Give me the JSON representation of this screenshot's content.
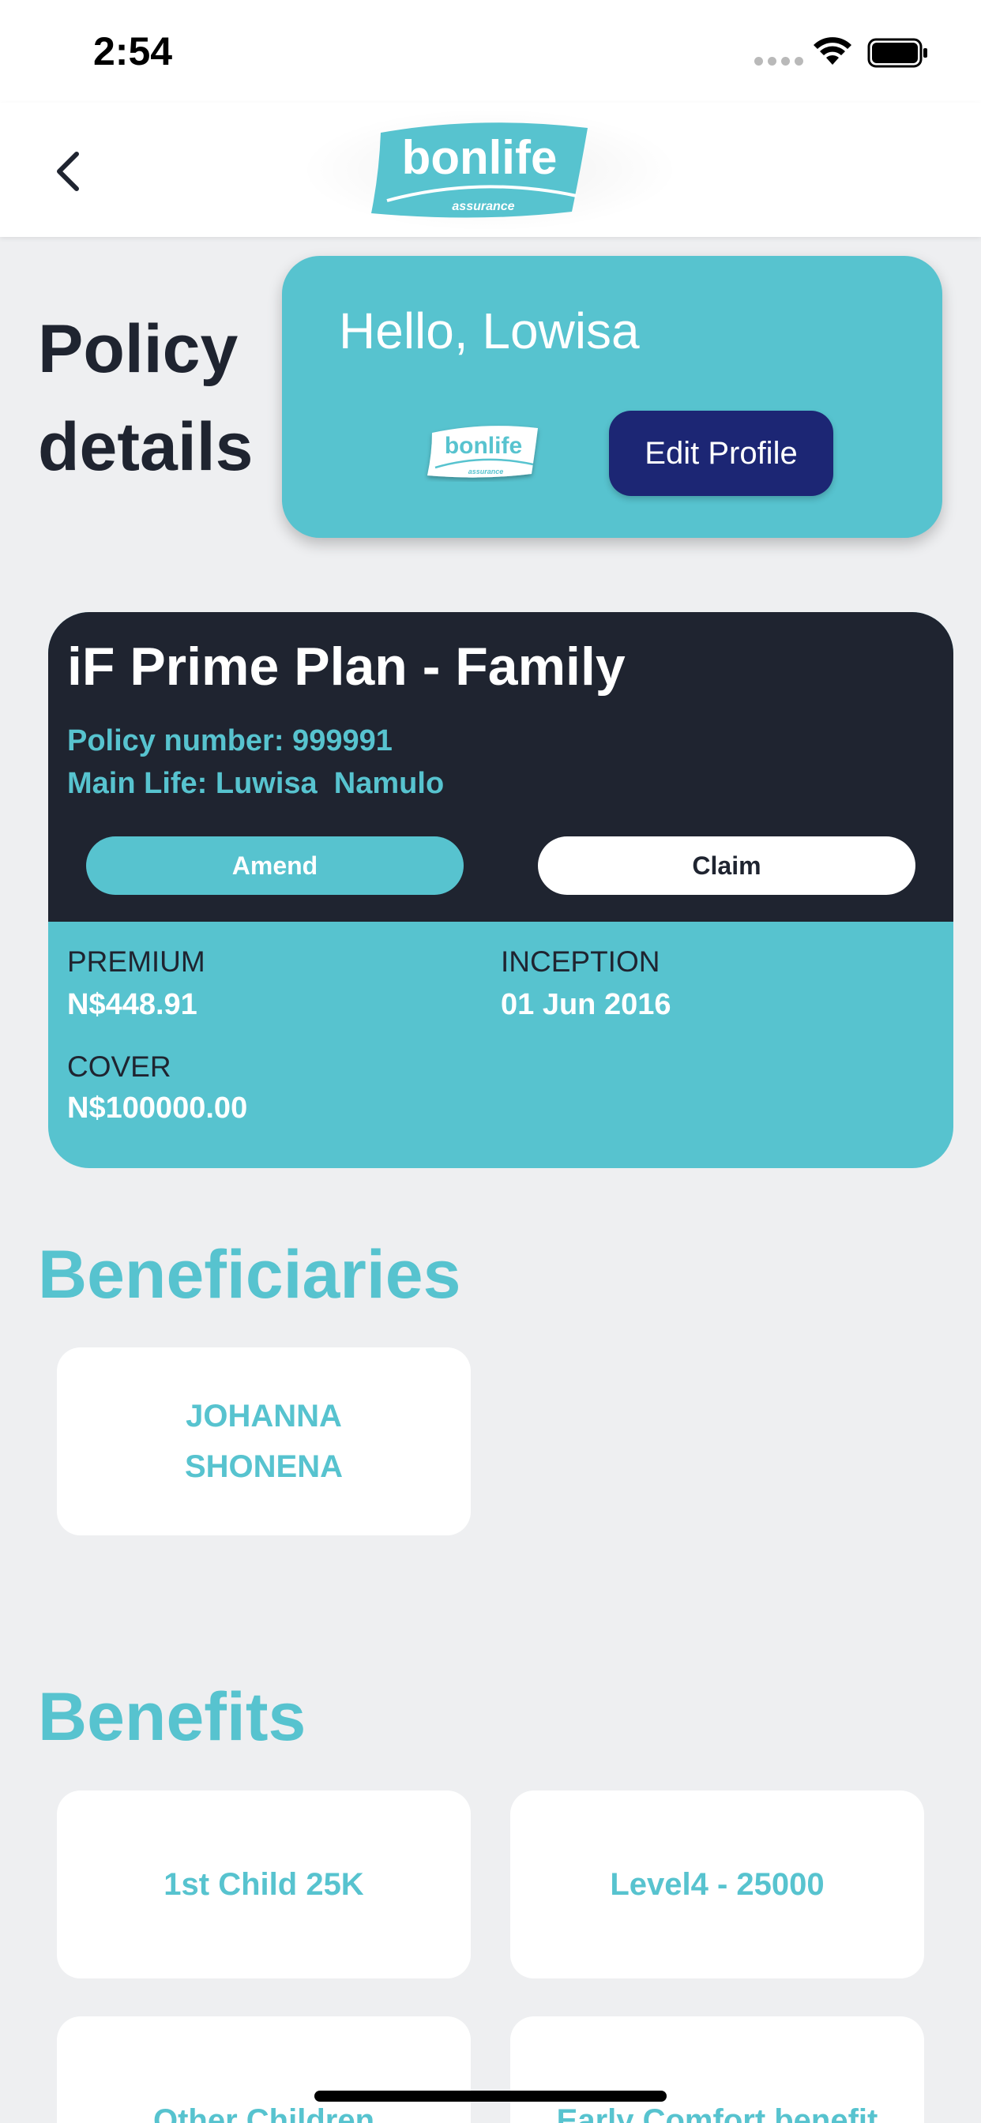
{
  "status_bar": {
    "time": "2:54",
    "icons": [
      "cellular-signal-icon",
      "wifi-icon",
      "battery-icon"
    ]
  },
  "nav": {
    "back_icon": "chevron-left-icon",
    "logo_text": "bonlife",
    "logo_subtext": "assurance"
  },
  "page_title": "Policy details",
  "profile_card": {
    "greeting": "Hello, Lowisa",
    "logo_text": "bonlife",
    "logo_subtext": "assurance",
    "edit_button_label": "Edit Profile"
  },
  "policy": {
    "plan_name": "iF Prime Plan - Family",
    "policy_number": "Policy number: 999991",
    "main_life": "Main Life: Luwisa  Namulo",
    "amend_label": "Amend",
    "claim_label": "Claim",
    "premium_label": "PREMIUM",
    "premium_value": "N$448.91",
    "inception_label": "INCEPTION",
    "inception_value": "01 Jun 2016",
    "cover_label": "COVER",
    "cover_value": "N$100000.00"
  },
  "beneficiaries": {
    "heading": "Beneficiaries",
    "items": [
      "JOHANNA\nSHONENA"
    ]
  },
  "benefits": {
    "heading": "Benefits",
    "items": [
      "1st Child 25K",
      "Level4 -  25000",
      "Other Children",
      "Early Comfort benefit"
    ]
  },
  "colors": {
    "accent": "#57c3cf",
    "dark": "#1f2430",
    "button_navy": "#1c2674",
    "background": "#eeeff1"
  }
}
